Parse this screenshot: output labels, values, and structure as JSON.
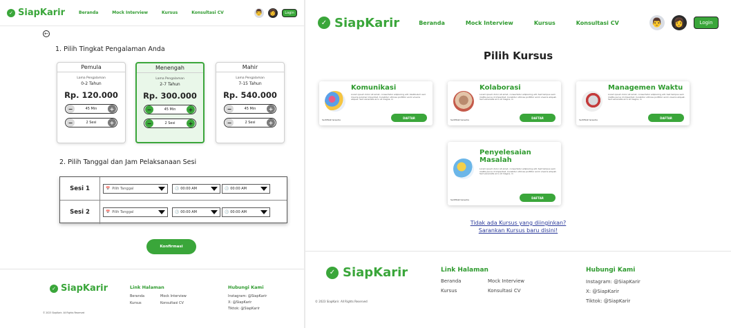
{
  "brand": {
    "name": "SiapKarir",
    "accent": "#3aa63a",
    "link_color": "#2b3a9b"
  },
  "nav": {
    "links": [
      "Beranda",
      "Mock Interview",
      "Kursus",
      "Konsultasi CV"
    ],
    "login": "Login",
    "avatars": [
      "user-avatar",
      "profile-avatar"
    ]
  },
  "left": {
    "back_icon": "back-arrow-icon",
    "step1_title": "1. Pilih Tingkat Pengalaman Anda",
    "step2_title": "2. Pilih Tanggal dan Jam Pelaksanaan Sesi",
    "levels": [
      {
        "name": "Pemula",
        "exp_label": "Lama Pengalaman",
        "years": "0-2 Tahun",
        "price": "Rp. 120.000",
        "duration": "45 Min",
        "sessions": "2 Sesi"
      },
      {
        "name": "Menengah",
        "exp_label": "Lama Pengalaman",
        "years": "2-7 Tahun",
        "price": "Rp. 300.000",
        "duration": "45 Min",
        "sessions": "2 Sesi"
      },
      {
        "name": "Mahir",
        "exp_label": "Lama Pengalaman",
        "years": "7-15 Tahun",
        "price": "Rp. 540.000",
        "duration": "45 Min",
        "sessions": "2 Sesi"
      }
    ],
    "selected_level": "Menengah",
    "sessions": [
      {
        "label": "Sesi 1",
        "date_placeholder": "Pilih Tanggal",
        "start": "00:00 AM",
        "end": "00:00 AM"
      },
      {
        "label": "Sesi 2",
        "date_placeholder": "Pilih Tanggal",
        "start": "00:00 AM",
        "end": "00:00 AM"
      }
    ],
    "confirm": "Konfirmasi"
  },
  "right": {
    "title": "Pilih Kursus",
    "courses": [
      {
        "title": "Komunikasi",
        "desc": "Lorem ipsum dolor sit amet, consectetur adipiscing elit. Vestibulum sed mauris pulvinar imperdiet. Curabitur ultrices porttitor enim viverra aliquet. Sed venenatis arcu at magna, in",
        "cert": "Sertifikat tersedia",
        "button": "DAFTAR"
      },
      {
        "title": "Kolaborasi",
        "desc": "Lorem ipsum dolor sit amet, consectetur adipiscing elit. Sed tempus sem mattis purus id imperdiet. Curabitur ultrices porttitor enim viverra aliquet. Sed venenatis arcu at magna, in",
        "cert": "Sertifikat tersedia",
        "button": "DAFTAR"
      },
      {
        "title": "Managemen Waktu",
        "desc": "Lorem ipsum dolor sit amet, consectetur adipiscing elit. Sed tempus sem mattis purus id imperdiet. Curabitur ultrices porttitor enim viverra aliquet. Sed venenatis arcu at magna, in",
        "cert": "Sertifikat tersedia",
        "button": "DAFTAR"
      },
      {
        "title": "Penyelesaian Masalah",
        "desc": "Lorem ipsum dolor sit amet, consectetur adipiscing elit. Sed tempus sem mattis purus id imperdiet. Curabitur ultrices porttitor enim viverra aliquet. Sed venenatis arcu at magna, in",
        "cert": "Sertifikat tersedia",
        "button": "DAFTAR"
      }
    ],
    "suggest_line1": "Tidak ada Kursus yang diinginkan?",
    "suggest_line2": "Sarankan Kursus baru disini!"
  },
  "footer": {
    "copyright": "© 2023 SiapKarir. All Rights Reserved",
    "links_title": "Link Halaman",
    "links": [
      "Beranda",
      "Mock Interview",
      "Kursus",
      "Konsultasi CV"
    ],
    "contact_title": "Hubungi Kami",
    "contacts": [
      "Instagram: @SiapKarir",
      "X: @SiapKarir",
      "Tiktok: @SiapKarir"
    ]
  }
}
